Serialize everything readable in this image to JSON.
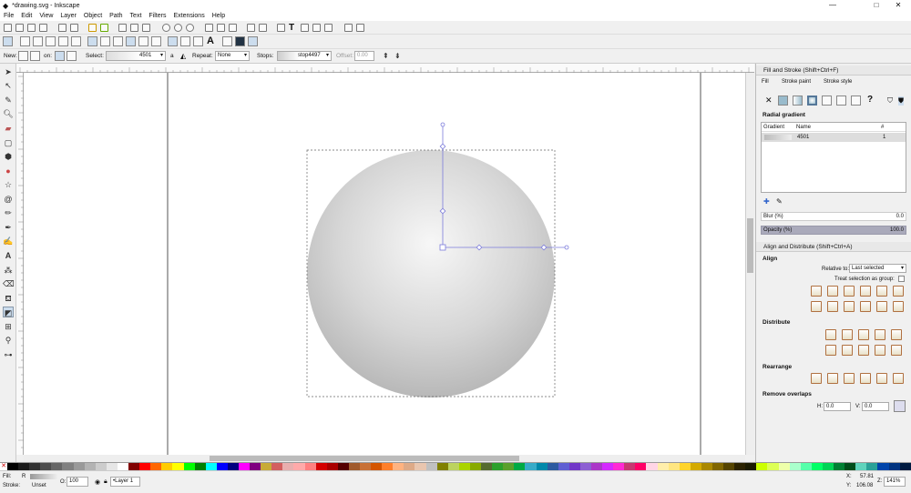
{
  "window": {
    "title": "*drawing.svg - Inkscape",
    "min": "—",
    "max": "□",
    "close": "✕"
  },
  "menu": [
    "File",
    "Edit",
    "View",
    "Layer",
    "Object",
    "Path",
    "Text",
    "Filters",
    "Extensions",
    "Help"
  ],
  "gradient_toolbar": {
    "new_label": "New:",
    "on_label": "on:",
    "select_label": "Select:",
    "select_value": "4501",
    "repeat_label": "Repeat:",
    "repeat_value": "None",
    "stops_label": "Stops:",
    "stops_value": "stop4497",
    "offset_label": "Offset:",
    "offset_value": "0.00"
  },
  "fill_stroke": {
    "title": "Fill and Stroke (Shift+Ctrl+F)",
    "tabs": [
      "Fill",
      "Stroke paint",
      "Stroke style"
    ],
    "mode_label": "Radial gradient",
    "table_headers": [
      "Gradient",
      "Name",
      "#"
    ],
    "rows": [
      {
        "name": "4501",
        "count": "1"
      }
    ],
    "blur_label": "Blur (%)",
    "blur_value": "0.0",
    "opacity_label": "Opacity (%)",
    "opacity_value": "100.0"
  },
  "align": {
    "title": "Align and Distribute (Shift+Ctrl+A)",
    "align_h": "Align",
    "relative_label": "Relative to:",
    "relative_value": "Last selected",
    "treat_label": "Treat selection as group:",
    "distribute_h": "Distribute",
    "rearrange_h": "Rearrange",
    "overlaps_h": "Remove overlaps",
    "h_label": "H:",
    "h_value": "0.0",
    "v_label": "V:",
    "v_value": "0.0"
  },
  "status": {
    "fill_label": "Fill:",
    "fill_value": "R",
    "stroke_label": "Stroke:",
    "stroke_value": "Unset",
    "o_label": "O:",
    "o_value": "100",
    "layer": "•Layer 1",
    "x_label": "X:",
    "x_value": "57.81",
    "y_label": "Y:",
    "y_value": "106.08",
    "z_label": "Z:",
    "zoom": "141%"
  },
  "colors": {
    "accent": "#7b7bdb",
    "gradient_light": "#f2f2f2",
    "gradient_dark": "#bdbdbd"
  },
  "palette": [
    "#000000",
    "#1a1a1a",
    "#333333",
    "#4d4d4d",
    "#666666",
    "#808080",
    "#999999",
    "#b3b3b3",
    "#cccccc",
    "#e6e6e6",
    "#ffffff",
    "#800000",
    "#ff0000",
    "#ff6600",
    "#ffcc00",
    "#ffff00",
    "#00ff00",
    "#008000",
    "#00ffff",
    "#0000ff",
    "#000080",
    "#ff00ff",
    "#800080",
    "#c8ab37",
    "#d35f5f",
    "#e9afaf",
    "#ffaaaa",
    "#ff8080",
    "#d40000",
    "#aa0000",
    "#550000",
    "#a05a2c",
    "#c87137",
    "#d45500",
    "#ff7f2a",
    "#ffb380",
    "#deaa87",
    "#e9c6af",
    "#c0c0c0",
    "#808000",
    "#bcd35f",
    "#aad400",
    "#88aa00",
    "#556b2f",
    "#2ca02c",
    "#5aa02c",
    "#00aa44",
    "#37abc8",
    "#0088aa",
    "#2c5aa0",
    "#5f5fd3",
    "#7137c8",
    "#8d5fd3",
    "#ab37c8",
    "#d42aff",
    "#ff2ad4",
    "#c83771",
    "#ff0066",
    "#ffd5e5",
    "#ffeeaa",
    "#ffe680",
    "#ffd42a",
    "#d4aa00",
    "#aa8800",
    "#806600",
    "#554400",
    "#2b2200",
    "#1a1a00",
    "#ccff00",
    "#ddff55",
    "#eeffaa",
    "#aaffcc",
    "#55ffaa",
    "#00ff66",
    "#00d455",
    "#008033",
    "#004d1a",
    "#5fd3bc",
    "#2aa198",
    "#0044aa",
    "#003380",
    "#001a40"
  ]
}
